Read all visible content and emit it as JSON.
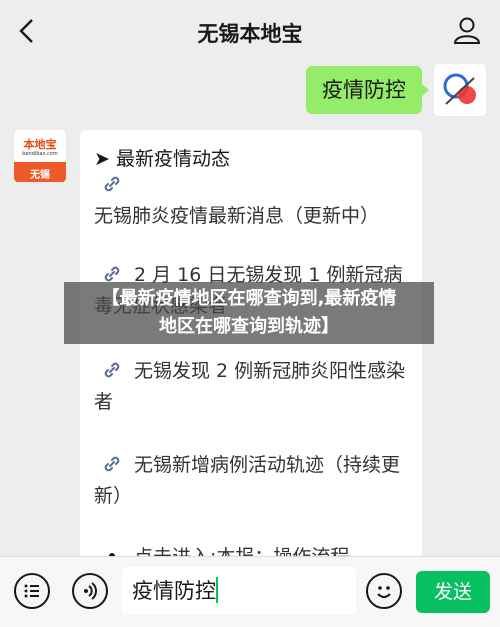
{
  "header": {
    "title": "无锡本地宝"
  },
  "outgoing": {
    "text": "疫情防控"
  },
  "bot_avatar": {
    "brand": "本地宝",
    "domain": "bendibao.com",
    "city": "无锡"
  },
  "card": {
    "heading": "➤ 最新疫情动态",
    "items": [
      "无锡肺炎疫情最新消息（更新中）",
      "2 月 16 日无锡发现 1 例新冠病毒无症状感染者",
      "无锡发现 2 例新冠肺炎阳性感染者",
      "无锡新增病例活动轨迹（持续更新）",
      "点击进入:本报：操作流程"
    ]
  },
  "banner": {
    "line1": "【最新疫情地区在哪查询到,最新疫情",
    "line2": "地区在哪查询到轨迹】"
  },
  "inputbar": {
    "value": "疫情防控",
    "send_label": "发送"
  },
  "colors": {
    "bg": "#ededed",
    "bubble_out": "#95ec69",
    "send": "#07c160",
    "link_icon": "#576b95"
  }
}
